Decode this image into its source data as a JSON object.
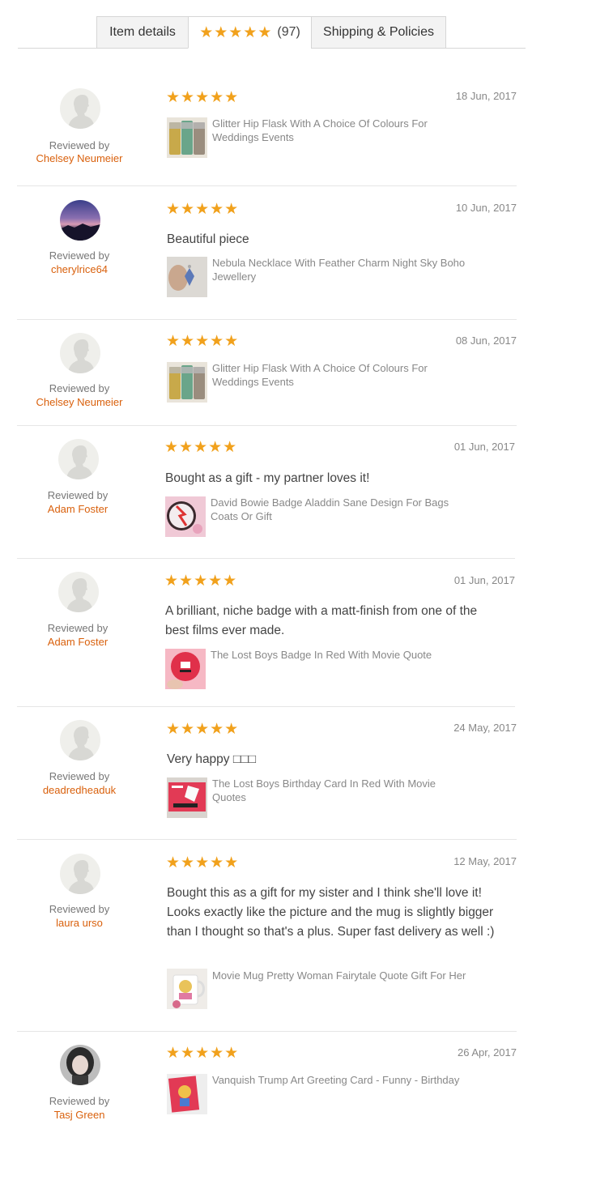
{
  "tabs": {
    "item_details": "Item details",
    "reviews_stars": "★★★★★",
    "reviews_count": "(97)",
    "shipping": "Shipping & Policies"
  },
  "common": {
    "reviewed_by": "Reviewed by",
    "stars": "★★★★★"
  },
  "reviews": [
    {
      "name": "Chelsey Neumeier",
      "date": "18 Jun, 2017",
      "text": "",
      "rating": 5,
      "item": "Glitter Hip Flask With A Choice Of Colours For Weddings Events",
      "avatar": "default-avatar",
      "thumb": "hip-flask"
    },
    {
      "name": "cherylrice64",
      "date": "10 Jun, 2017",
      "text": "Beautiful piece",
      "rating": 5,
      "item": "Nebula Necklace With Feather Charm Night Sky Boho Jewellery",
      "avatar": "night-sky-photo",
      "thumb": "necklace"
    },
    {
      "name": "Chelsey Neumeier",
      "date": "08 Jun, 2017",
      "text": "",
      "rating": 5,
      "item": "Glitter Hip Flask With A Choice Of Colours For Weddings Events",
      "avatar": "default-avatar",
      "thumb": "hip-flask"
    },
    {
      "name": "Adam Foster",
      "date": "01 Jun, 2017",
      "text": "Bought as a gift - my partner loves it!",
      "rating": 5,
      "item": "David Bowie Badge Aladdin Sane Design For Bags Coats Or Gift",
      "avatar": "default-avatar",
      "thumb": "bowie-badge"
    },
    {
      "name": "Adam Foster",
      "date": "01 Jun, 2017",
      "text": "A brilliant, niche badge with a matt-finish from one of the best films ever made.",
      "rating": 5,
      "item": "The Lost Boys Badge In Red With Movie Quote",
      "avatar": "default-avatar",
      "thumb": "red-badge"
    },
    {
      "name": "deadredheaduk",
      "date": "24 May, 2017",
      "text": "Very happy □□□",
      "rating": 5,
      "item": "The Lost Boys Birthday Card In Red With Movie Quotes",
      "avatar": "default-avatar",
      "thumb": "birthday-card"
    },
    {
      "name": "laura urso",
      "date": "12 May, 2017",
      "text": "Bought this as a gift for my sister and I think she'll love it! Looks exactly like the picture and the mug is slightly bigger than I thought so that's a plus. Super fast delivery as well :)",
      "rating": 5,
      "item": "Movie Mug Pretty Woman Fairytale Quote Gift For Her",
      "avatar": "default-avatar",
      "thumb": "mug"
    },
    {
      "name": "Tasj Green",
      "date": "26 Apr, 2017",
      "text": "",
      "rating": 5,
      "item": "Vanquish Trump Art Greeting Card - Funny - Birthday",
      "avatar": "portrait-photo",
      "thumb": "greeting-card"
    }
  ],
  "colors": {
    "star": "#f1a11c",
    "reviewer_link": "#d9600c",
    "muted_text": "#888888",
    "divider": "#e6e6e6"
  }
}
